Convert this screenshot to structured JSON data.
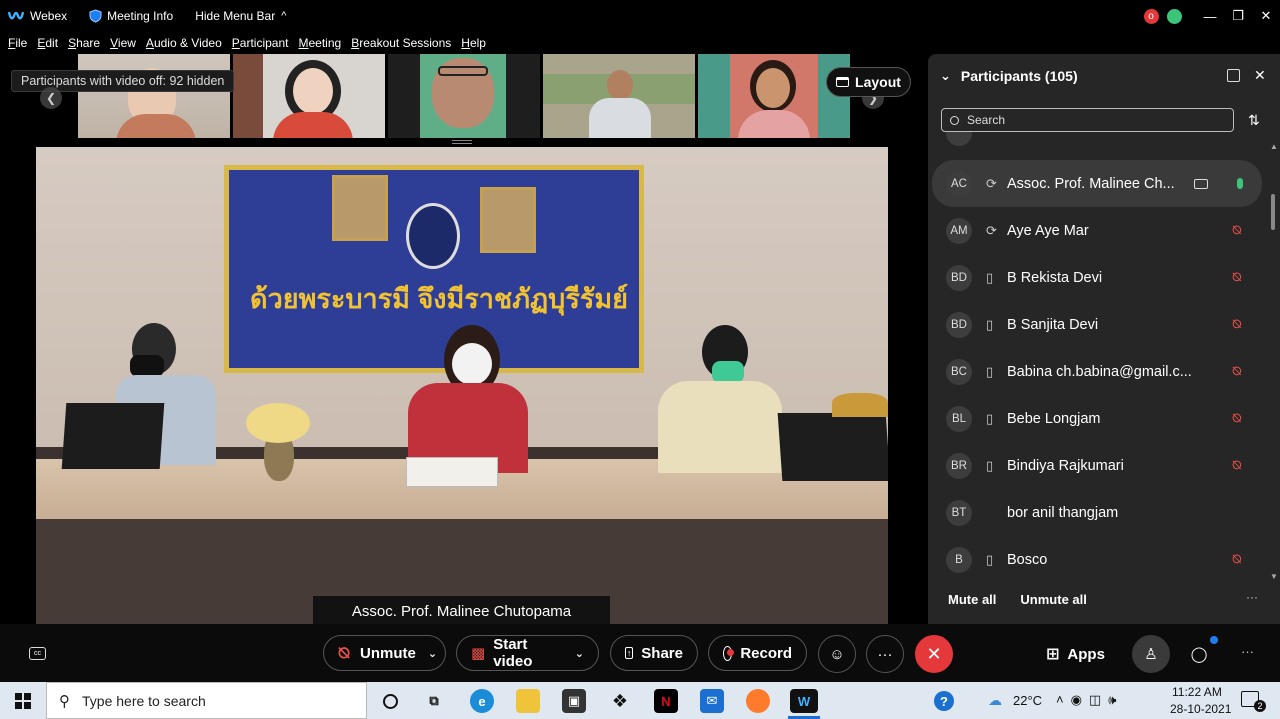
{
  "titlebar": {
    "app_name": "Webex",
    "meeting_info": "Meeting Info",
    "hide_menu": "Hide Menu Bar",
    "chevron": "^",
    "avatar_initial": "o"
  },
  "menu": [
    "File",
    "Edit",
    "Share",
    "View",
    "Audio & Video",
    "Participant",
    "Meeting",
    "Breakout Sessions",
    "Help"
  ],
  "stage": {
    "tooltip": "Participants with video off: 92 hidden",
    "layout_label": "Layout",
    "active_speaker": "Assoc. Prof. Malinee Chutopama",
    "banner_text": "ด้วยพระบารมี จึงมีราชภัฏบุรีรัมย์"
  },
  "panel": {
    "title": "Participants (105)",
    "search_placeholder": "Search",
    "participants": [
      {
        "initials": "AC",
        "name": "Assoc. Prof. Malinee Ch...",
        "device": "headset",
        "mic": "on",
        "video": true,
        "active": true
      },
      {
        "initials": "AM",
        "name": "Aye Aye Mar",
        "device": "headset",
        "mic": "muted",
        "video": false,
        "active": false
      },
      {
        "initials": "BD",
        "name": "B Rekista Devi",
        "device": "phone",
        "mic": "muted",
        "video": false,
        "active": false
      },
      {
        "initials": "BD",
        "name": "B Sanjita Devi",
        "device": "phone",
        "mic": "muted",
        "video": false,
        "active": false
      },
      {
        "initials": "BC",
        "name": "Babina ch.babina@gmail.c...",
        "device": "phone",
        "mic": "muted",
        "video": false,
        "active": false
      },
      {
        "initials": "BL",
        "name": "Bebe Longjam",
        "device": "phone",
        "mic": "muted",
        "video": false,
        "active": false
      },
      {
        "initials": "BR",
        "name": "Bindiya Rajkumari",
        "device": "phone",
        "mic": "muted",
        "video": false,
        "active": false
      },
      {
        "initials": "BT",
        "name": "bor anil thangjam",
        "device": "none",
        "mic": "none",
        "video": false,
        "active": false
      },
      {
        "initials": "B",
        "name": "Bosco",
        "device": "phone",
        "mic": "muted",
        "video": false,
        "active": false
      }
    ],
    "mute_all": "Mute all",
    "unmute_all": "Unmute all",
    "more": "···"
  },
  "controls": {
    "unmute": "Unmute",
    "start_video": "Start video",
    "share": "Share",
    "record": "Record",
    "more": "···",
    "apps": "Apps"
  },
  "taskbar": {
    "search_placeholder": "Type here to search",
    "temperature": "22°C",
    "time": "11:22 AM",
    "date": "28-10-2021",
    "notif_count": "2"
  },
  "colors": {
    "end_call": "#e5383b",
    "record_dot": "#e5383b",
    "muted_red": "#e8504a",
    "mic_green": "#3cc47a",
    "accent_blue": "#1c7ef0"
  }
}
